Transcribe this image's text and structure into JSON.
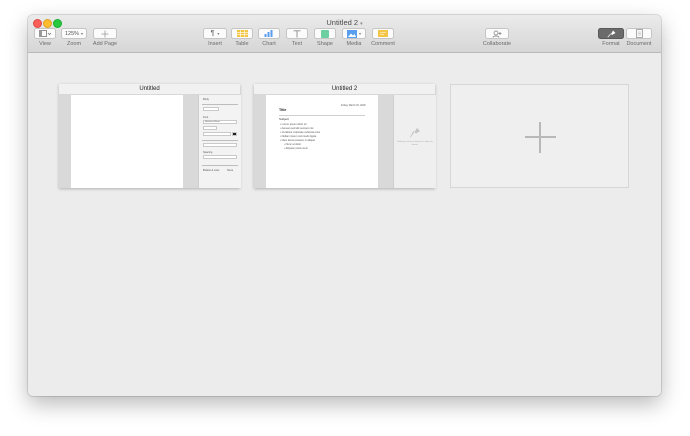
{
  "window": {
    "title": "Untitled 2"
  },
  "toolbar": {
    "view_label": "View",
    "zoom_value": "125%",
    "zoom_label": "Zoom",
    "add_page_label": "Add Page",
    "insert_label": "Insert",
    "table_label": "Table",
    "chart_label": "Chart",
    "text_label": "Text",
    "shape_label": "Shape",
    "media_label": "Media",
    "comment_label": "Comment",
    "collaborate_label": "Collaborate",
    "format_label": "Format",
    "document_label": "Document"
  },
  "documents": [
    {
      "title": "Untitled",
      "panel": {
        "header": "Body",
        "font_label": "Font",
        "font_value": "Helvetica Neue",
        "spacing_label": "Spacing",
        "bullets_label": "Bullets & Lists",
        "bullets_value": "None"
      }
    },
    {
      "title": "Untitled 2",
      "date": "Friday, March 23, 2018",
      "heading": "Title",
      "subheading": "Subject",
      "bullets": [
        "Lorem ipsum dolor sit",
        "Aenean sed elit semper nisi",
        "Curabitur vulputate vehicula enim",
        "Nullam ipsum commodo ligula",
        "Nam lacus posuere in aliquet",
        "Nunc at dolor",
        "Aliquam porta nunc"
      ],
      "empty_inspector_text": "Nothing selected. Select an object to format."
    }
  ],
  "icons": {
    "view": "sidebar-icon",
    "zoom": "chevron-down-icon",
    "add_page": "plus-icon",
    "insert": "paragraph-icon",
    "table": "table-icon",
    "chart": "bar-chart-icon",
    "text": "text-t-icon",
    "shape": "shape-square-icon",
    "media": "image-icon",
    "comment": "comment-icon",
    "collaborate": "collaborate-icon",
    "format": "paintbrush-icon",
    "document": "document-icon",
    "new_document": "plus-icon"
  },
  "colors": {
    "close": "#fc5f57",
    "minimize": "#fdbc2e",
    "maximize": "#28c840",
    "table_icon": "#f3c545",
    "chart_icon": "#5a9ef0",
    "shape_icon": "#6ccf9f",
    "media_icon": "#5a9ef0",
    "comment_icon": "#f3c545",
    "format_selected": "#6b6b6b"
  }
}
